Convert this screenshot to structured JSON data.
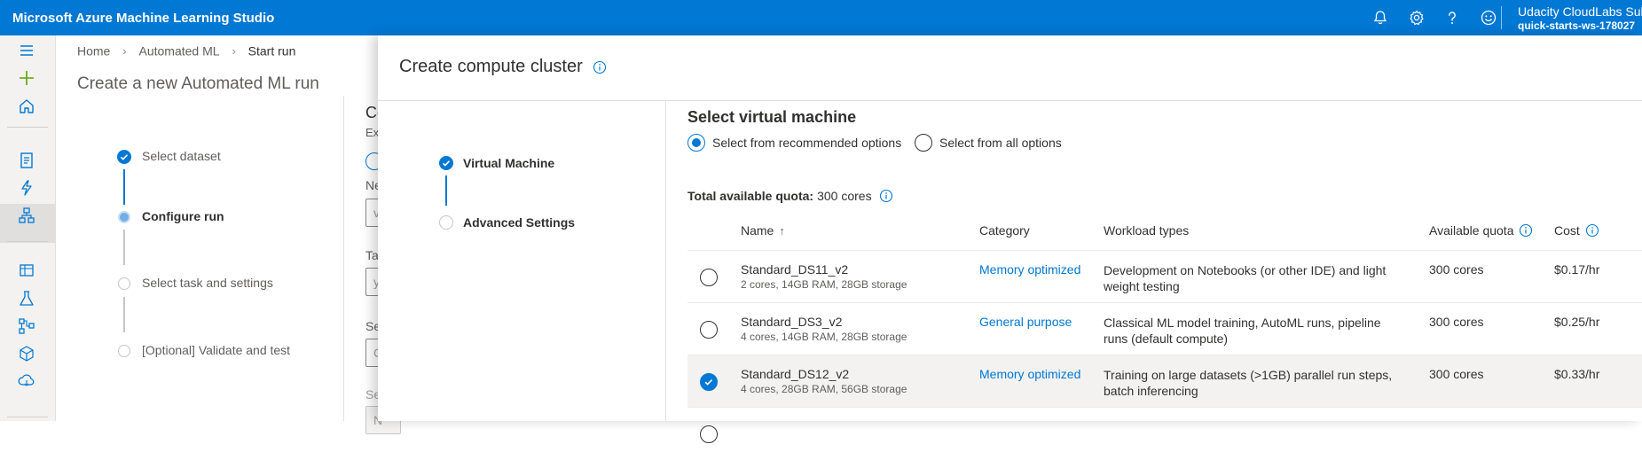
{
  "topbar": {
    "title": "Microsoft Azure Machine Learning Studio",
    "icons": [
      "notifications-icon",
      "settings-icon",
      "help-icon",
      "feedback-icon"
    ],
    "account_name": "Udacity CloudLabs Sub",
    "workspace": "quick-starts-ws-178027"
  },
  "rail": {
    "icons": [
      "hamburger-icon",
      "new-icon",
      "home-icon",
      "notebook-icon",
      "automl-icon",
      "designer-icon",
      "datasets-icon",
      "experiments-icon",
      "pipelines-icon",
      "models-icon",
      "endpoints-icon"
    ]
  },
  "page": {
    "breadcrumb": [
      "Home",
      "Automated ML",
      "Start run"
    ],
    "title": "Create a new Automated ML run",
    "steps": [
      {
        "label": "Select dataset",
        "state": "done"
      },
      {
        "label": "Configure run",
        "state": "current"
      },
      {
        "label": "Select task and settings",
        "state": "pending"
      },
      {
        "label": "[Optional] Validate and test",
        "state": "pending"
      }
    ],
    "peek": {
      "c": "Co",
      "ex": "Ex",
      "ne": "Ne",
      "v": "v",
      "ta": "Ta",
      "y": "y",
      "se1": "Se",
      "c2": "C",
      "se2": "Se",
      "n": "N"
    }
  },
  "panel": {
    "title": "Create compute cluster",
    "wizard": [
      {
        "label": "Virtual Machine",
        "state": "done"
      },
      {
        "label": "Advanced Settings",
        "state": "pending"
      }
    ],
    "section_title": "Select virtual machine",
    "radio_options": [
      {
        "label": "Select from recommended options",
        "selected": true
      },
      {
        "label": "Select from all options",
        "selected": false
      }
    ],
    "quota_label": "Total available quota:",
    "quota_value": "300 cores",
    "table": {
      "headers": {
        "name": "Name",
        "category": "Category",
        "workload": "Workload types",
        "quota": "Available quota",
        "cost": "Cost"
      },
      "rows": [
        {
          "name": "Standard_DS11_v2",
          "spec": "2 cores, 14GB RAM, 28GB storage",
          "category": "Memory optimized",
          "workload": "Development on Notebooks (or other IDE) and light weight testing",
          "quota": "300 cores",
          "cost": "$0.17/hr",
          "selected": false
        },
        {
          "name": "Standard_DS3_v2",
          "spec": "4 cores, 14GB RAM, 28GB storage",
          "category": "General purpose",
          "workload": "Classical ML model training, AutoML runs, pipeline runs (default compute)",
          "quota": "300 cores",
          "cost": "$0.25/hr",
          "selected": false
        },
        {
          "name": "Standard_DS12_v2",
          "spec": "4 cores, 28GB RAM, 56GB storage",
          "category": "Memory optimized",
          "workload": "Training on large datasets (>1GB) parallel run steps, batch inferencing",
          "quota": "300 cores",
          "cost": "$0.33/hr",
          "selected": true
        }
      ]
    }
  },
  "colors": {
    "brand": "#0078d4",
    "rail_bg": "#f3f2f1",
    "selected_row": "#f3f2f1"
  }
}
